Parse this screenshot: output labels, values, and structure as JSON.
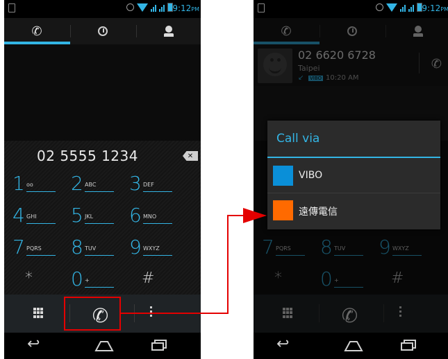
{
  "left_phone": {
    "status_time": "9:12",
    "status_ampm": "PM",
    "number": "02 5555 1234",
    "keys": [
      {
        "digit": "1",
        "letters": "ᴏᴏ"
      },
      {
        "digit": "2",
        "letters": "ABC"
      },
      {
        "digit": "3",
        "letters": "DEF"
      },
      {
        "digit": "4",
        "letters": "GHI"
      },
      {
        "digit": "5",
        "letters": "JKL"
      },
      {
        "digit": "6",
        "letters": "MNO"
      },
      {
        "digit": "7",
        "letters": "PQRS"
      },
      {
        "digit": "8",
        "letters": "TUV"
      },
      {
        "digit": "9",
        "letters": "WXYZ"
      },
      {
        "digit": "*",
        "letters": ""
      },
      {
        "digit": "0",
        "letters": "+"
      },
      {
        "digit": "#",
        "letters": ""
      }
    ]
  },
  "right_phone": {
    "status_time": "9:12",
    "status_ampm": "PM",
    "contact_number": "02 6620 6728",
    "contact_city": "Taipei",
    "contact_sim": "VIBO",
    "contact_time": "10:20 AM",
    "dialog": {
      "title": "Call via",
      "options": [
        {
          "name": "VIBO",
          "color": "#0a8fd8"
        },
        {
          "name": "遠傳電信",
          "color": "#ff6a00"
        }
      ]
    },
    "keys_visible": [
      {
        "digit": "7",
        "letters": "PQRS"
      },
      {
        "digit": "8",
        "letters": "TUV"
      },
      {
        "digit": "9",
        "letters": "WXYZ"
      },
      {
        "digit": "*",
        "letters": ""
      },
      {
        "digit": "0",
        "letters": "+"
      },
      {
        "digit": "#",
        "letters": ""
      }
    ]
  },
  "accent_color": "#33b5e5",
  "highlight_color": "#e40000"
}
